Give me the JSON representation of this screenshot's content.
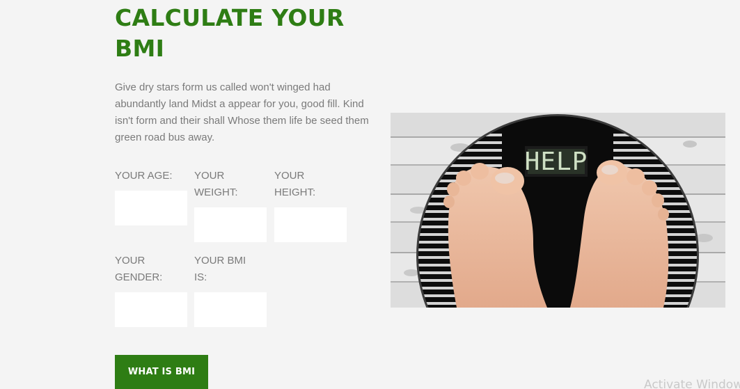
{
  "bmi": {
    "title": "CALCULATE YOUR BMI",
    "description": "Give dry stars form us called won't winged had abundantly land Midst a appear for you, good fill. Kind isn't form and their shall Whose them life be seed them green road bus away.",
    "fields": {
      "age": {
        "label": "YOUR AGE:",
        "value": ""
      },
      "weight": {
        "label": "YOUR WEIGHT:",
        "value": ""
      },
      "height": {
        "label": "YOUR HEIGHT:",
        "value": ""
      },
      "gender": {
        "label": "YOUR GENDER:",
        "value": ""
      },
      "bmi": {
        "label": "YOUR BMI IS:",
        "value": ""
      }
    },
    "button_label": "WHAT IS BMI"
  },
  "image": {
    "scale_display_text": "HELP"
  },
  "watermark": {
    "text": "Activate Windows"
  },
  "colors": {
    "accent": "#2e7d14",
    "background": "#f4f4f4",
    "body_text": "#7a7a7a"
  }
}
